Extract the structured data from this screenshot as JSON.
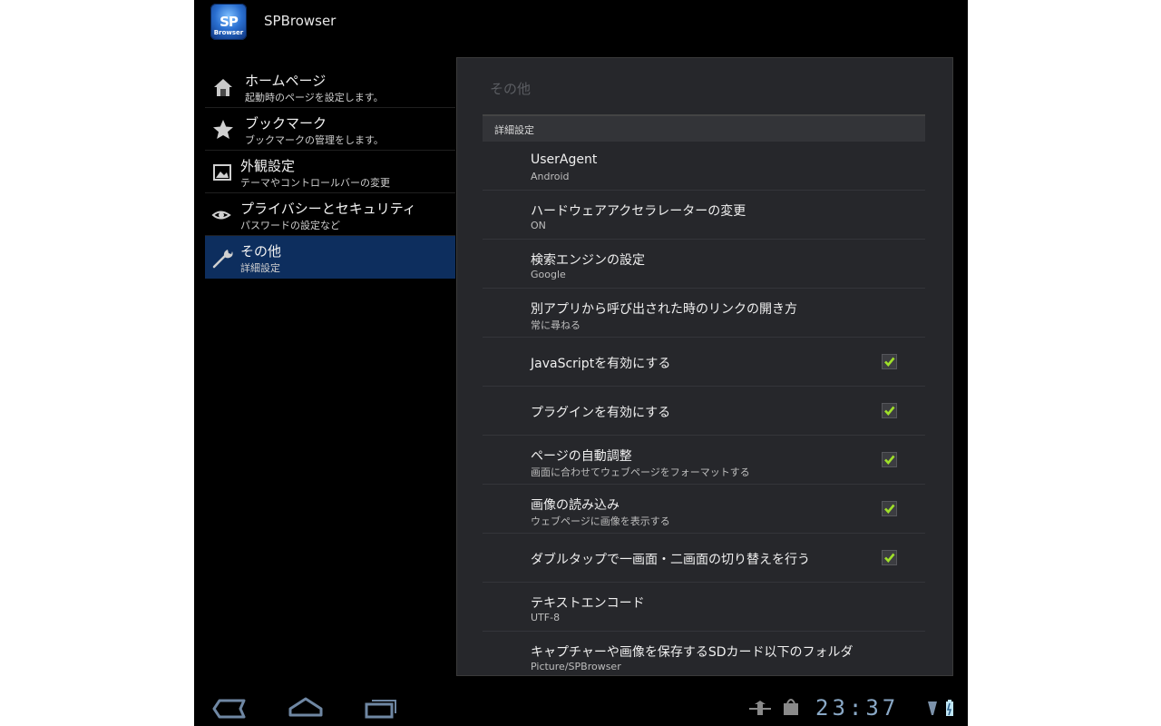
{
  "app": {
    "title": "SPBrowser",
    "icon_text_top": "SP",
    "icon_text_bottom": "Browser"
  },
  "sidebar": {
    "items": [
      {
        "title": "ホームページ",
        "subtitle": "起動時のページを設定します。",
        "icon": "home-icon",
        "active": false
      },
      {
        "title": "ブックマーク",
        "subtitle": "ブックマークの管理をします。",
        "icon": "star-icon",
        "active": false
      },
      {
        "title": "外観設定",
        "subtitle": "テーマやコントロールバーの変更",
        "icon": "picture-icon",
        "active": false
      },
      {
        "title": "プライバシーとセキュリティ",
        "subtitle": "パスワードの設定など",
        "icon": "eye-icon",
        "active": false
      },
      {
        "title": "その他",
        "subtitle": "詳細設定",
        "icon": "wrench-icon",
        "active": true
      }
    ]
  },
  "panel": {
    "header": "その他",
    "section": "詳細設定",
    "rows": [
      {
        "title": "UserAgent",
        "subtitle": "Android",
        "checked": null
      },
      {
        "title": "ハードウェアアクセラレーターの変更",
        "subtitle": "ON",
        "checked": null
      },
      {
        "title": "検索エンジンの設定",
        "subtitle": "Google",
        "checked": null
      },
      {
        "title": "別アプリから呼び出された時のリンクの開き方",
        "subtitle": "常に尋ねる",
        "checked": null
      },
      {
        "title": "JavaScriptを有効にする",
        "subtitle": "",
        "checked": true
      },
      {
        "title": "プラグインを有効にする",
        "subtitle": "",
        "checked": true
      },
      {
        "title": "ページの自動調整",
        "subtitle": "画面に合わせてウェブページをフォーマットする",
        "checked": true
      },
      {
        "title": "画像の読み込み",
        "subtitle": "ウェブページに画像を表示する",
        "checked": true
      },
      {
        "title": "ダブルタップで一画面・二画面の切り替えを行う",
        "subtitle": "",
        "checked": true
      },
      {
        "title": "テキストエンコード",
        "subtitle": "UTF-8",
        "checked": null
      },
      {
        "title": "キャプチャーや画像を保存するSDカード以下のフォルダ",
        "subtitle": "Picture/SPBrowser",
        "checked": null
      }
    ]
  },
  "navbar": {
    "buttons": [
      "back-icon",
      "home-icon",
      "recent-apps-icon"
    ],
    "status_icons": [
      "usb-debug-icon",
      "shop-bag-icon",
      "signal-icon",
      "battery-icon"
    ],
    "clock": "23:37"
  },
  "colors": {
    "accent_check": "#9fe02a",
    "active_bg": "#0d2e5e",
    "clock": "#8aa9c7"
  }
}
